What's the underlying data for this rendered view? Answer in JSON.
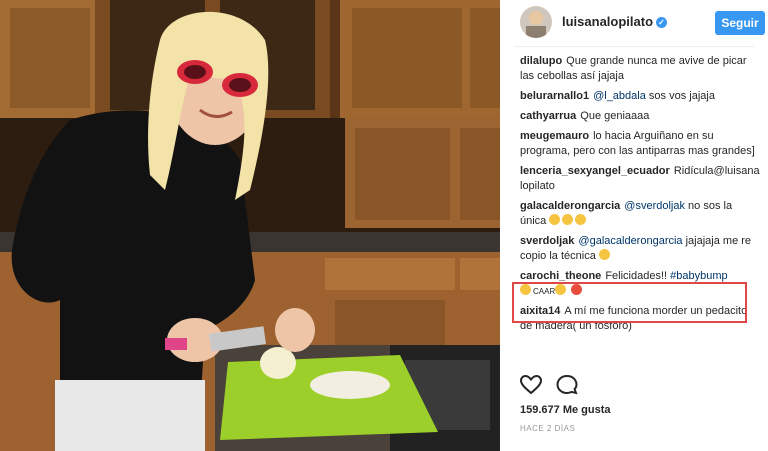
{
  "post": {
    "username": "luisanalopilato",
    "verified": "✓",
    "follow_label": "Seguir",
    "likes": "159.677 Me gusta",
    "time": "HACE 2 DÍAS"
  },
  "comments": [
    {
      "user": "dilalupo",
      "text": "Que grande nunca me avive de picar las cebollas así jajaja"
    },
    {
      "user": "belurarnallo1",
      "mention": "@l_abdala",
      "text": "sos vos jajaja"
    },
    {
      "user": "cathyarrua",
      "text": "Que geniaaaa"
    },
    {
      "user": "meugemauro",
      "text": "lo hacia Arguiñano en su programa, pero con las antiparras mas grandes]"
    },
    {
      "user": "lenceria_sexyangel_ecuador",
      "text": "Ridícula@luisana lopilato"
    },
    {
      "user": "galacalderongarcia",
      "mention": "@sverdoljak",
      "text": "no sos la única"
    },
    {
      "user": "sverdoljak",
      "mention": "@galacalderongarcia",
      "text": "jajajaja me re copio la técnica"
    },
    {
      "user": "carochi_theone",
      "text": "Felicidades!!",
      "hashtag": "#babybump",
      "extra": "CAAR"
    },
    {
      "user": "aixita14",
      "text": "A mí me funciona morder un pedacito de madera( un fosforo)"
    }
  ],
  "icons": {
    "heart": "heart-icon",
    "comment": "comment-icon"
  },
  "colors": {
    "accent": "#3897f0",
    "highlight": "#e04848",
    "board": "#9ccf2a"
  }
}
